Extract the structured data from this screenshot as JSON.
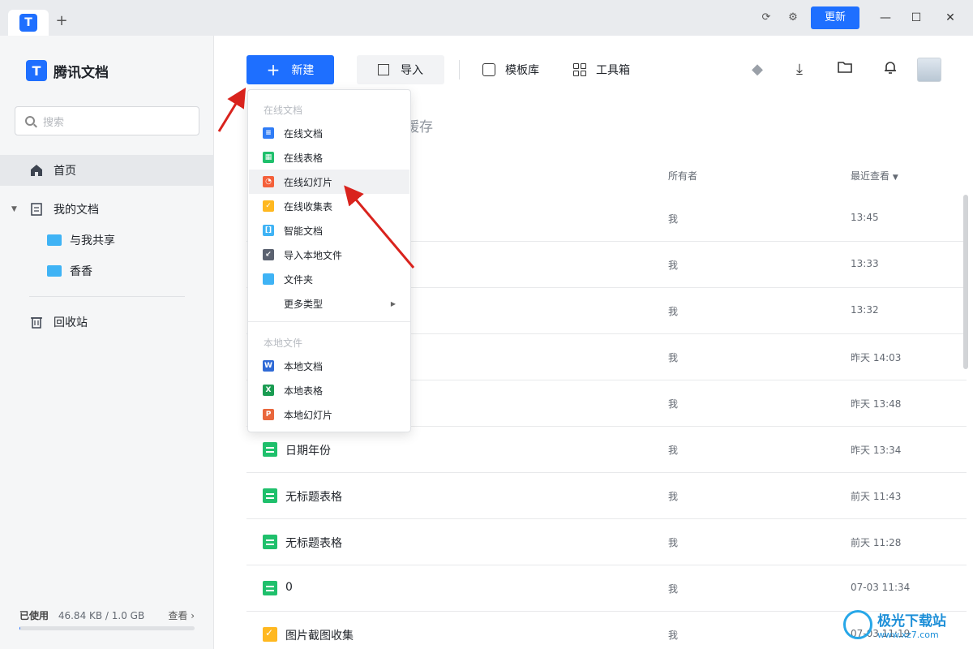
{
  "titlebar": {
    "add_tab": "+",
    "update_label": "更新",
    "icons": [
      "refresh-icon",
      "settings-icon"
    ],
    "window_controls": [
      "minimize",
      "maximize",
      "close"
    ]
  },
  "sidebar": {
    "brand": "腾讯文档",
    "search_placeholder": "搜索",
    "nav": {
      "home": "首页",
      "my_docs": "我的文档",
      "shared": "与我共享",
      "folder": "香香",
      "trash": "回收站"
    },
    "storage": {
      "used_label": "已使用",
      "used_value": "46.84 KB / 1.0 GB",
      "view_label": "查看",
      "used_fraction": 5e-05
    }
  },
  "toolbar": {
    "new_label": "新建",
    "import_label": "导入",
    "template_label": "模板库",
    "toolbox_label": "工具箱",
    "right_icons": [
      "diamond-icon",
      "download-icon",
      "folder-open-icon",
      "bell-icon",
      "avatar"
    ]
  },
  "content": {
    "cache_tab": "缓存",
    "columns": {
      "owner": "所有者",
      "recent": "最近查看"
    },
    "rows": [
      {
        "name": "",
        "owner": "我",
        "time": "13:45",
        "icon": ""
      },
      {
        "name": "",
        "owner": "我",
        "time": "13:33",
        "icon": ""
      },
      {
        "name": "",
        "owner": "我",
        "time": "13:32",
        "icon": ""
      },
      {
        "name": "",
        "owner": "我",
        "time": "昨天 14:03",
        "icon": ""
      },
      {
        "name": "",
        "owner": "我",
        "time": "昨天 13:48",
        "icon": ""
      },
      {
        "name": "日期年份",
        "owner": "我",
        "time": "昨天 13:34",
        "icon": "sheet"
      },
      {
        "name": "无标题表格",
        "owner": "我",
        "time": "前天 11:43",
        "icon": "sheet"
      },
      {
        "name": "无标题表格",
        "owner": "我",
        "time": "前天 11:28",
        "icon": "sheet"
      },
      {
        "name": "0",
        "owner": "我",
        "time": "07-03 11:34",
        "icon": "sheet"
      },
      {
        "name": "图片截图收集",
        "owner": "我",
        "time": "07-03 11:19",
        "icon": "form"
      }
    ]
  },
  "dropdown": {
    "online_section": "在线文档",
    "online_items": [
      {
        "label": "在线文档",
        "color": "#2f7cf6",
        "glyph": "≡"
      },
      {
        "label": "在线表格",
        "color": "#1fc06c",
        "glyph": "▦"
      },
      {
        "label": "在线幻灯片",
        "color": "#f4603a",
        "glyph": "◔"
      },
      {
        "label": "在线收集表",
        "color": "#ffb820",
        "glyph": "✓"
      },
      {
        "label": "智能文档",
        "color": "#3fb3f5",
        "glyph": "[]"
      },
      {
        "label": "导入本地文件",
        "color": "#5b6270",
        "glyph": "↙"
      },
      {
        "label": "文件夹",
        "color": "#3fb3f5",
        "glyph": ""
      },
      {
        "label": "更多类型",
        "color": "",
        "glyph": ""
      }
    ],
    "local_section": "本地文件",
    "local_items": [
      {
        "label": "本地文档",
        "color": "#2f6ad6",
        "glyph": "W"
      },
      {
        "label": "本地表格",
        "color": "#1a9c52",
        "glyph": "X"
      },
      {
        "label": "本地幻灯片",
        "color": "#e9673c",
        "glyph": "P"
      }
    ]
  },
  "watermark": {
    "title": "极光下载站",
    "url": "www.xz7.com"
  },
  "colors": {
    "accent": "#1e6fff",
    "arrow": "#d9231d"
  }
}
